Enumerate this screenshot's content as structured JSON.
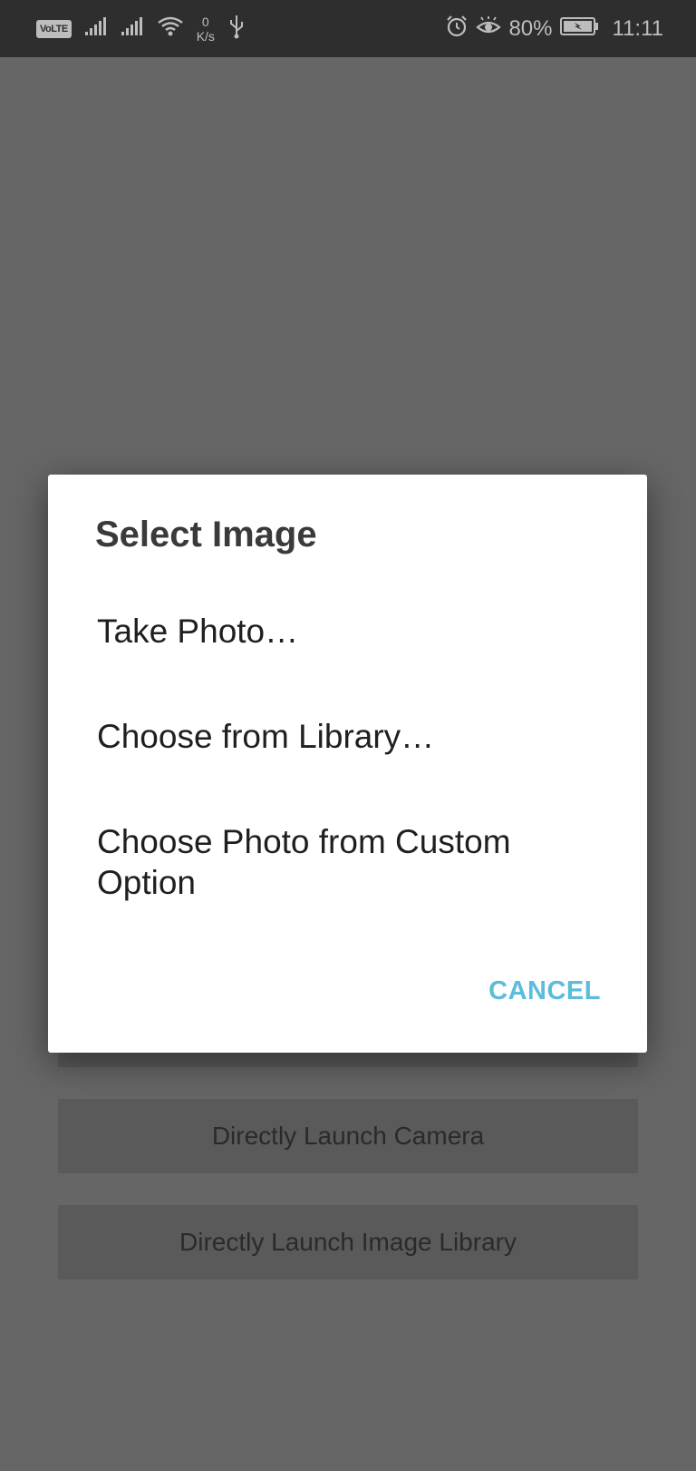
{
  "status_bar": {
    "volte": "VoLTE",
    "net_speed_value": "0",
    "net_speed_unit": "K/s",
    "battery_percent": "80%",
    "time": "11:11",
    "icons": [
      "signal-icon",
      "signal-icon",
      "wifi-icon",
      "usb-icon",
      "alarm-icon",
      "eye-comfort-icon",
      "battery-charging-icon"
    ]
  },
  "background": {
    "camera_button": "Directly Launch Camera",
    "library_button": "Directly Launch Image Library"
  },
  "dialog": {
    "title": "Select Image",
    "options": [
      "Take Photo…",
      "Choose from Library…",
      "Choose Photo from Custom Option"
    ],
    "cancel_label": "CANCEL",
    "accent_color": "#5cbcdc"
  }
}
